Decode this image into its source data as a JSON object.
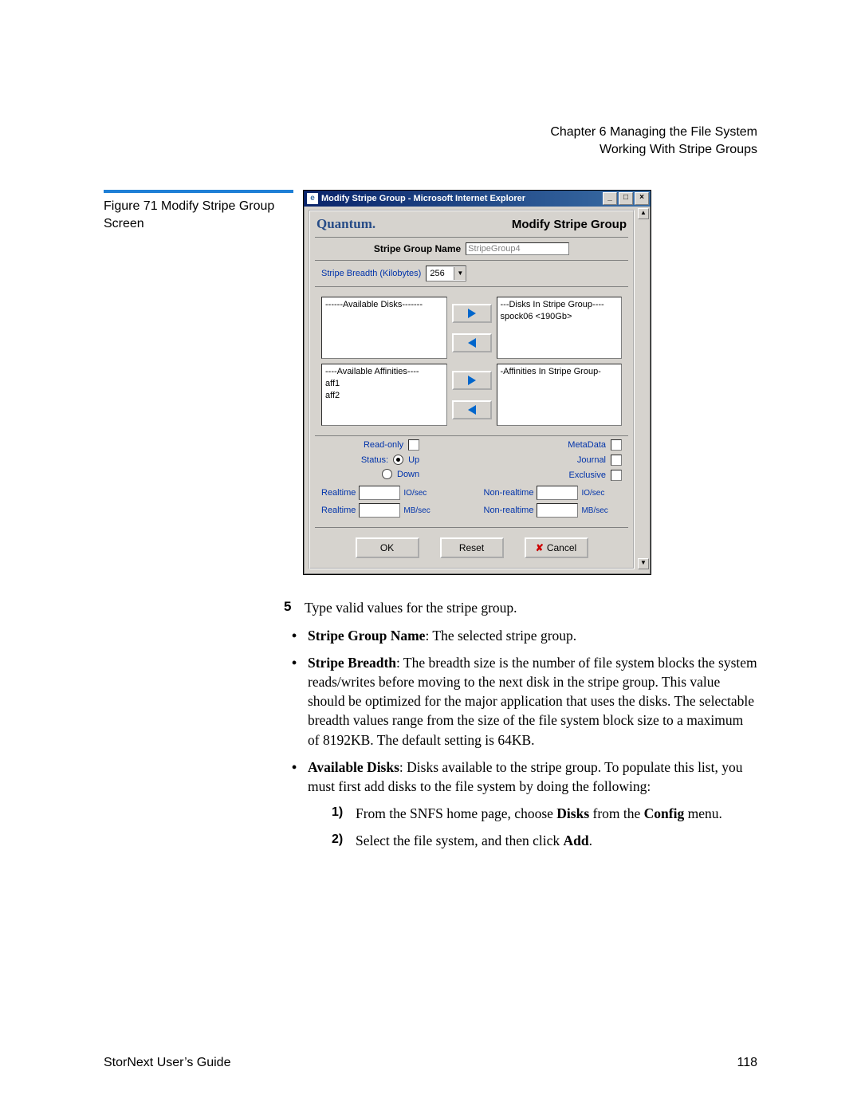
{
  "header": {
    "chapter": "Chapter 6  Managing the File System",
    "section": "Working With Stripe Groups"
  },
  "figure_caption": {
    "label": "Figure 71  Modify Stripe Group Screen"
  },
  "ie": {
    "title": "Modify Stripe Group - Microsoft Internet Explorer",
    "brand": "Quantum.",
    "page_title": "Modify Stripe Group",
    "name_label": "Stripe Group Name",
    "name_value": "StripeGroup4",
    "breadth_label": "Stripe Breadth (Kilobytes)",
    "breadth_value": "256",
    "disks": {
      "left_header": "------Available Disks-------",
      "right_header": "---Disks In Stripe Group----",
      "right_item": "spock06 <190Gb>"
    },
    "aff": {
      "left_header": "----Available Affinities----",
      "left_item1": "aff1",
      "left_item2": "aff2",
      "right_header": "-Affinities In Stripe Group-"
    },
    "opts": {
      "readonly": "Read-only",
      "status": "Status:",
      "up": "Up",
      "down": "Down",
      "metadata": "MetaData",
      "journal": "Journal",
      "exclusive": "Exclusive"
    },
    "io": {
      "realtime": "Realtime",
      "nonrealtime": "Non-realtime",
      "iosec": "IO/sec",
      "mbsec": "MB/sec"
    },
    "buttons": {
      "ok": "OK",
      "reset": "Reset",
      "cancel": "Cancel"
    }
  },
  "body": {
    "step5_num": "5",
    "step5_text": "Type valid values for the stripe group.",
    "b1_label": "Stripe Group Name",
    "b1_text": ": The selected stripe group.",
    "b2_label": "Stripe Breadth",
    "b2_text": ": The breadth size is the number of file system blocks the system reads/writes before moving to the next disk in the stripe group. This value should be optimized for the major application that uses the disks. The selectable breadth values range from the size of the file system block size to a maximum of 8192KB. The default setting is 64KB.",
    "b3_label": "Available Disks",
    "b3_text": ": Disks available to the stripe group. To populate this list, you must first add disks to the file system by doing the following:",
    "s1_num": "1)",
    "s1_a": "From the SNFS home page, choose ",
    "s1_b": "Disks",
    "s1_c": " from the ",
    "s1_d": "Config",
    "s1_e": " menu.",
    "s2_num": "2)",
    "s2_a": "Select the file system, and then click ",
    "s2_b": "Add",
    "s2_c": "."
  },
  "footer": {
    "left": "StorNext User’s Guide",
    "right": "118"
  }
}
